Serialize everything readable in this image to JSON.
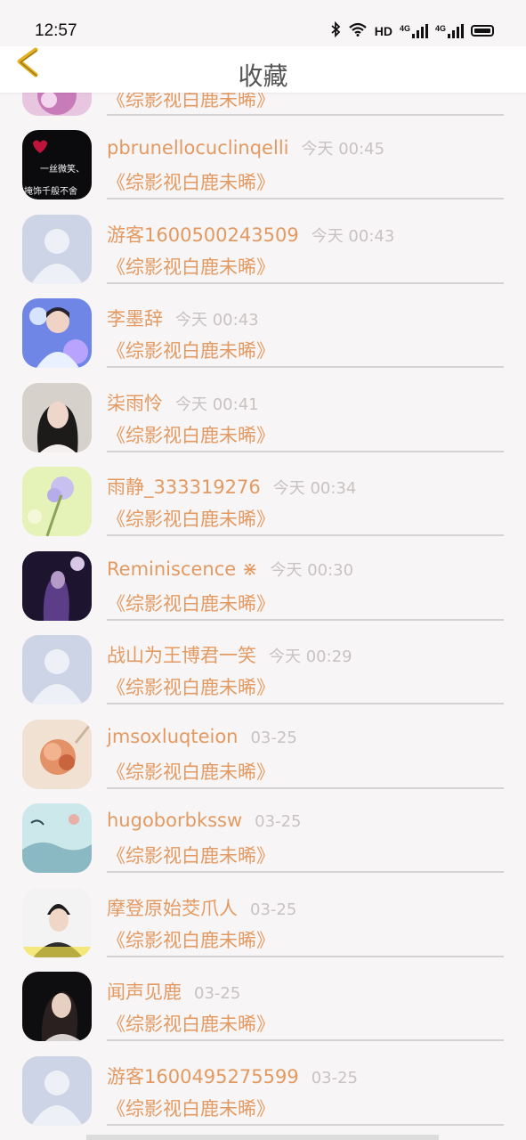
{
  "status_bar": {
    "time": "12:57",
    "hd_label": "HD",
    "net1": "4G",
    "net2": "4G"
  },
  "header": {
    "title": "收藏",
    "back_icon": "chevron-left-icon",
    "accent": "#e6b020"
  },
  "colors": {
    "name": "#e39a62",
    "time": "#c8c2c2",
    "divider": "#d6d2d2"
  },
  "partial_item": {
    "title": "《综影视白鹿未晞》"
  },
  "items": [
    {
      "name": "pbrunellocuclinqelli",
      "time": "今天 00:45",
      "title": "《综影视白鹿未晞》"
    },
    {
      "name": "游客1600500243509",
      "time": "今天 00:43",
      "title": "《综影视白鹿未晞》"
    },
    {
      "name": "李墨辞",
      "time": "今天 00:43",
      "title": "《综影视白鹿未晞》"
    },
    {
      "name": "柒雨怜",
      "time": "今天 00:41",
      "title": "《综影视白鹿未晞》"
    },
    {
      "name": "雨静_333319276",
      "time": "今天 00:34",
      "title": "《综影视白鹿未晞》"
    },
    {
      "name": "Reminiscence ⋇",
      "time": "今天 00:30",
      "title": "《综影视白鹿未晞》"
    },
    {
      "name": "战山为王博君一笑",
      "time": "今天 00:29",
      "title": "《综影视白鹿未晞》"
    },
    {
      "name": "jmsoxluqteion",
      "time": "03-25",
      "title": "《综影视白鹿未晞》"
    },
    {
      "name": "hugoborbkssw",
      "time": "03-25",
      "title": "《综影视白鹿未晞》"
    },
    {
      "name": "摩登原始茭爪人",
      "time": "03-25",
      "title": "《综影视白鹿未晞》"
    },
    {
      "name": "闻声见鹿",
      "time": "03-25",
      "title": "《综影视白鹿未晞》"
    },
    {
      "name": "游客1600495275599",
      "time": "03-25",
      "title": "《综影视白鹿未晞》"
    }
  ],
  "avatar_text": {
    "item0_line1": "一丝微笑、",
    "item0_line2": "掩饰千般不舍"
  }
}
